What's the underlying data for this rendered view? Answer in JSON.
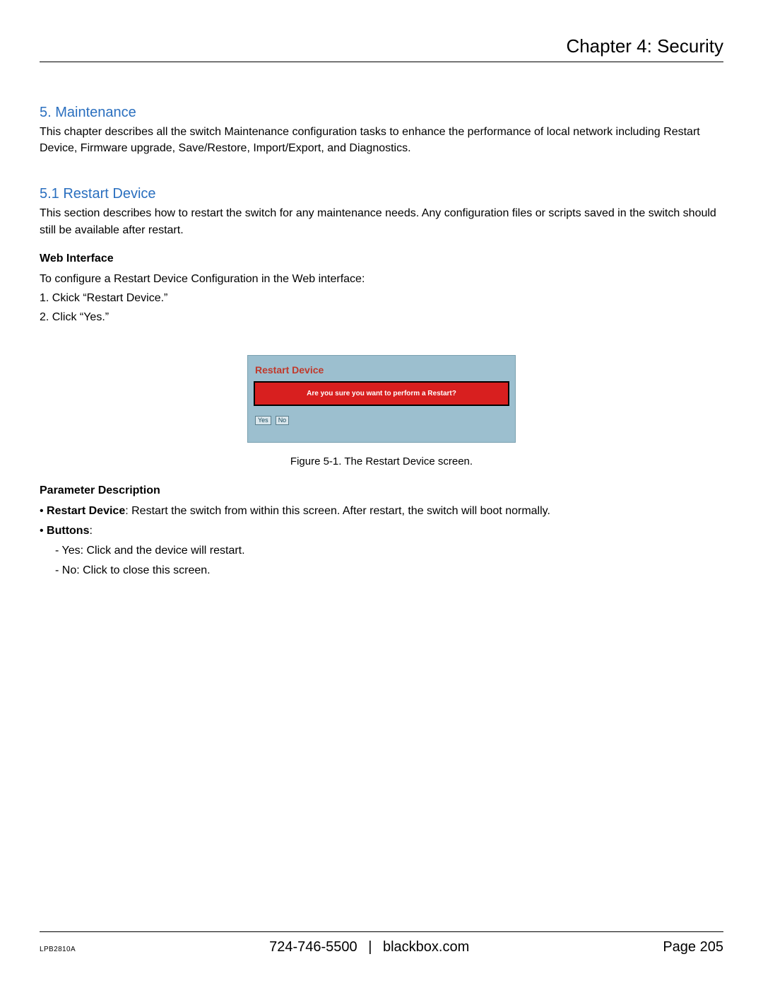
{
  "header": {
    "chapter": "Chapter 4: Security"
  },
  "sec5": {
    "title": "5. Maintenance",
    "body": "This chapter describes all the switch Maintenance configuration tasks to enhance the performance of local network including Restart Device, Firmware upgrade, Save/Restore, Import/Export, and Diagnostics."
  },
  "sec51": {
    "title": "5.1 Restart Device",
    "body": "This section describes how to restart the switch for any maintenance needs. Any configuration files or scripts saved in the switch should still be available after restart.",
    "web_heading": "Web Interface",
    "web_intro": "To configure a Restart Device Configuration in the Web interface:",
    "steps": [
      "1. Ckick “Restart Device.”",
      "2. Click “Yes.”"
    ]
  },
  "screenshot": {
    "panel_title": "Restart Device",
    "prompt": "Are you sure you want to perform a Restart?",
    "yes": "Yes",
    "no": "No",
    "caption": "Figure 5-1. The Restart Device screen."
  },
  "params": {
    "heading": "Parameter Description",
    "restart_label": "Restart Device",
    "restart_text": ": Restart the switch from within this screen. After restart, the switch will boot normally.",
    "buttons_label": "Buttons",
    "buttons_text": ":",
    "yes_line": "- Yes: Click and the device will restart.",
    "no_line": "- No: Click to close this screen."
  },
  "footer": {
    "model": "LPB2810A",
    "phone": "724-746-5500",
    "site": "blackbox.com",
    "page_label": "Page",
    "page_num": "205"
  }
}
